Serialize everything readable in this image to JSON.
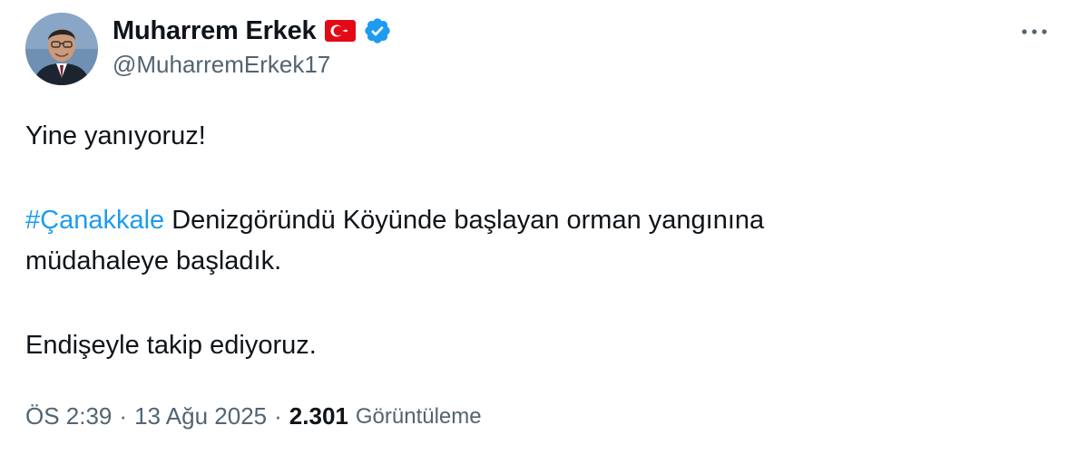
{
  "author": {
    "display_name": "Muharrem Erkek",
    "handle": "@MuharremErkek17",
    "flag_icon": "turkey-flag-icon",
    "verified_icon": "verified-badge-icon",
    "verified_color": "#1d9bf0",
    "flag_color": "#e30a17"
  },
  "menu": {
    "icon": "more-options-icon"
  },
  "tweet": {
    "line1": "Yine yanıyoruz!",
    "hashtag": "#Çanakkale",
    "line2_rest": " Denizgöründü Köyünde başlayan orman yangınına",
    "line3": "müdahaleye başladık.",
    "line4": "Endişeyle takip ediyoruz."
  },
  "meta": {
    "time": "ÖS 2:39",
    "separator": "·",
    "date": "13 Ağu 2025",
    "views_count": "2.301",
    "views_label": "Görüntüleme"
  },
  "colors": {
    "text": "#0f1419",
    "secondary": "#536471",
    "link": "#1d9bf0"
  }
}
